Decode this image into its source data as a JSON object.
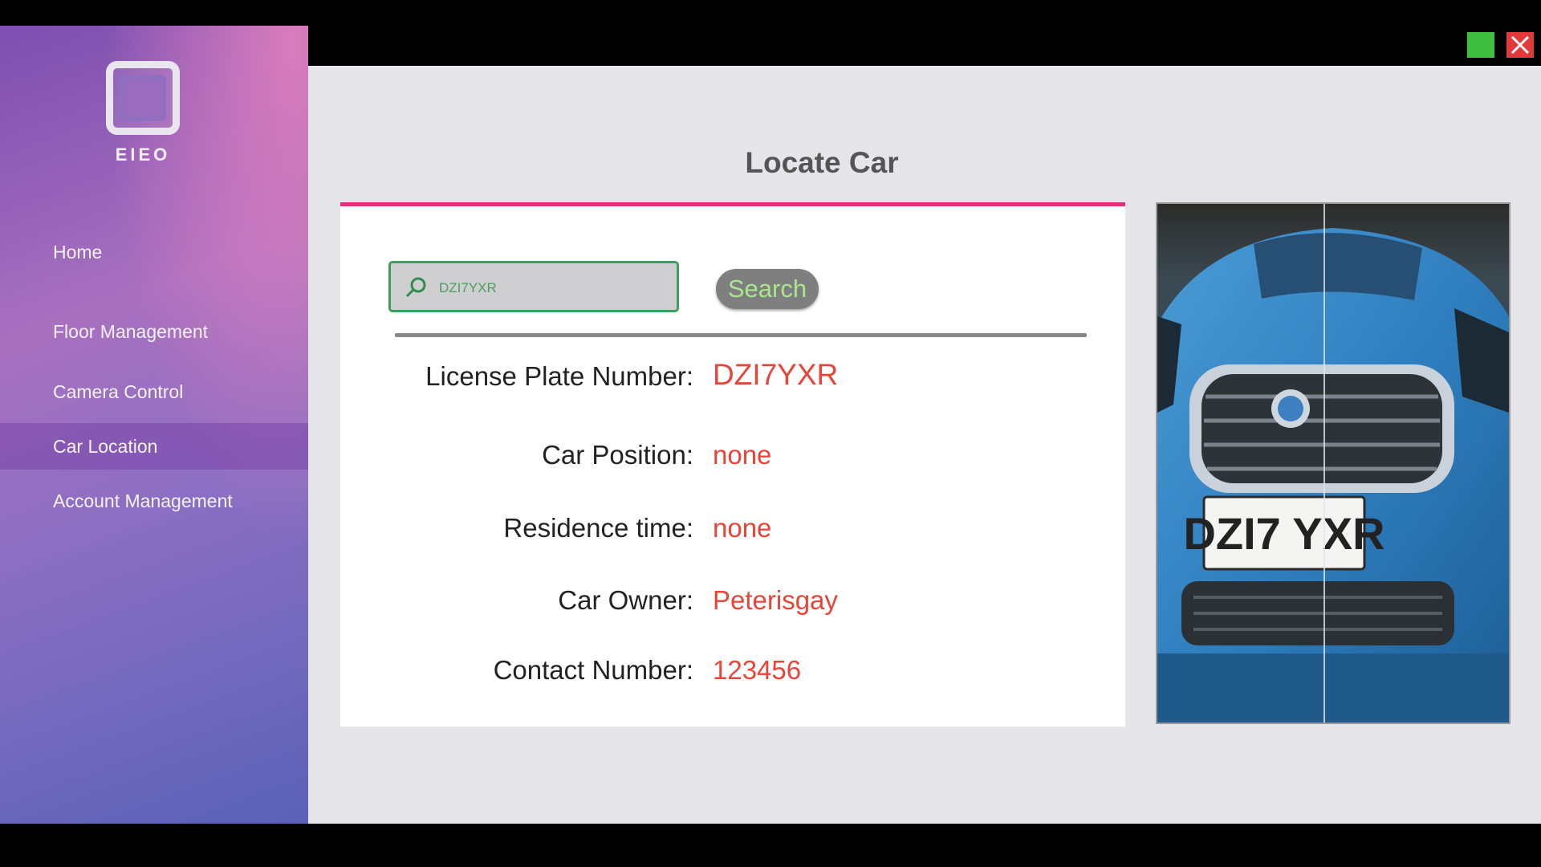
{
  "sidebar": {
    "logo_text": "EIEO",
    "items": [
      {
        "label": "Home"
      },
      {
        "label": "Floor Management"
      },
      {
        "label": "Camera Control"
      },
      {
        "label": "Car Location",
        "active": true
      },
      {
        "label": "Account Management"
      }
    ]
  },
  "window": {
    "minimize_icon": "green-square-icon",
    "close_icon": "close-x-icon"
  },
  "main": {
    "title": "Locate Car",
    "search": {
      "value": "DZI7YXR",
      "button_label": "Search"
    },
    "details": [
      {
        "label": "License Plate Number:",
        "value": "DZI7YXR"
      },
      {
        "label": "Car Position:",
        "value": "none"
      },
      {
        "label": "Residence time:",
        "value": "none"
      },
      {
        "label": "Car Owner:",
        "value": "Peterisgay"
      },
      {
        "label": "Contact Number:",
        "value": "123456"
      }
    ],
    "image": {
      "plate_text": "DZI7 YXR"
    }
  },
  "colors": {
    "accent": "#e62e7a",
    "value_text": "#e84438",
    "search_border": "#3aa05c",
    "search_button_text": "#a8e68f"
  }
}
